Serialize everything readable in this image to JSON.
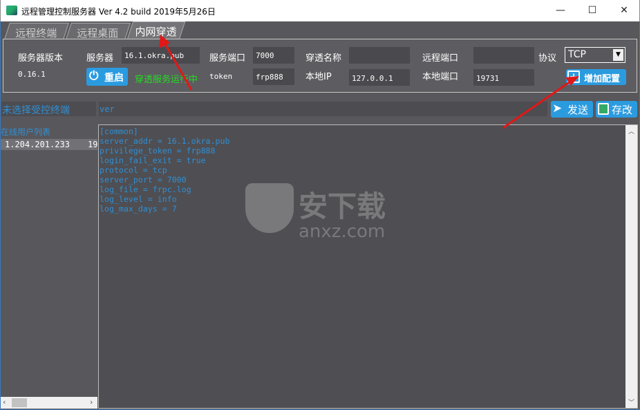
{
  "window": {
    "title": "远程管理控制服务器 Ver 4.2 build 2019年5月26日",
    "minimize": "—",
    "maximize": "☐",
    "close": "✕"
  },
  "tabs": [
    {
      "label": "远程终端"
    },
    {
      "label": "远程桌面"
    },
    {
      "label": "内网穿透",
      "active": true
    }
  ],
  "panel": {
    "version_label": "服务器版本",
    "version_value": "0.16.1",
    "server_label": "服务器",
    "server_value": "16.1.okra.pub",
    "port_label": "服务端口",
    "port_value": "7000",
    "name_label": "穿透名称",
    "name_value": "",
    "remote_port_label": "远程端口",
    "remote_port_value": "",
    "protocol_label": "协议",
    "protocol_value": "TCP",
    "restart_label": "重启",
    "status_text": "穿透服务运行中",
    "token_label": "token",
    "token_value": "frp888",
    "local_ip_label": "本地IP",
    "local_ip_value": "127.0.0.1",
    "local_port_label": "本地端口",
    "local_port_value": "19731",
    "add_config_label": "增加配置"
  },
  "terminal_select": "未选择受控终端",
  "command_input": "ver",
  "send_label": "发送",
  "save_label": "存改",
  "user_list": {
    "header": "在线用户列表",
    "rows": [
      {
        "ip": "1.204.201.233",
        "extra": "19"
      }
    ]
  },
  "config_lines": [
    "[common]",
    "server_addr = 16.1.okra.pub",
    "privilege_token = frp888",
    "login_fail_exit = true",
    "protocol = tcp",
    "server_port = 7000",
    "log_file = frpc.log",
    "log_level = info",
    "log_max_days = 7"
  ],
  "watermark": "安下载 anxz.com",
  "colors": {
    "accent": "#2b9be0",
    "status": "#22dd22",
    "text_blue": "#2f8fd5",
    "arrow": "#e01818"
  }
}
